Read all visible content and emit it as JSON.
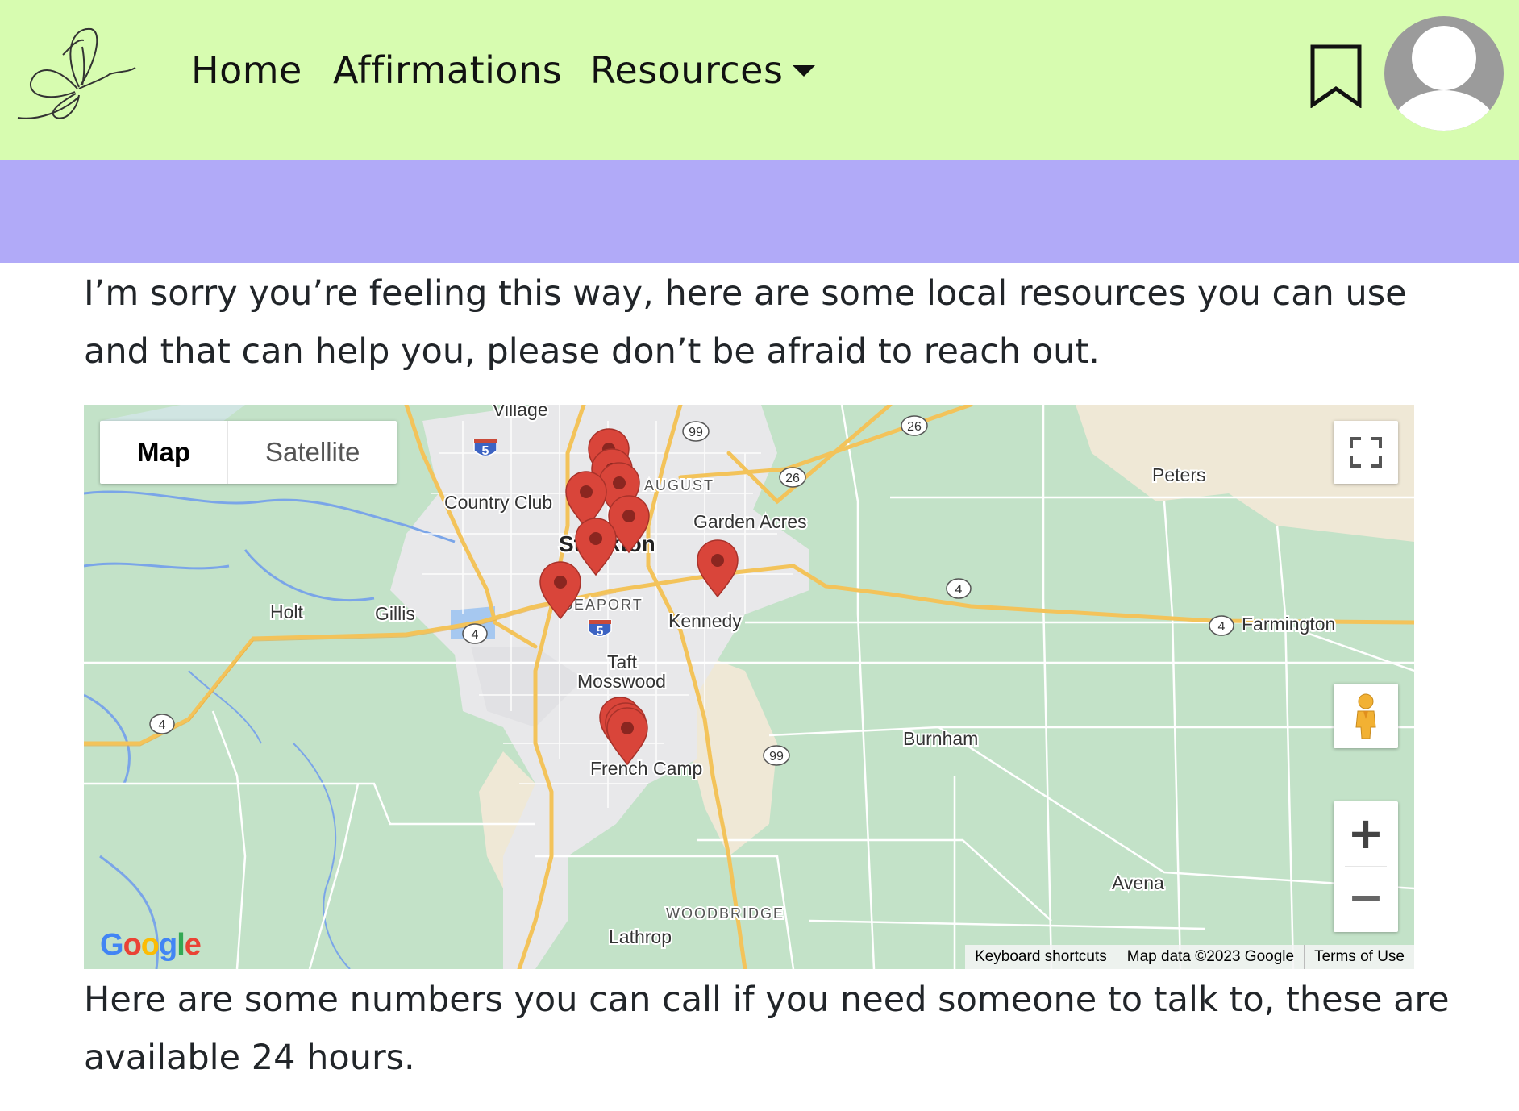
{
  "nav": {
    "links": [
      "Home",
      "Affirmations",
      "Resources"
    ]
  },
  "content": {
    "intro": "I’m sorry you’re feeling this way, here are some local resources you can use and that can help you, please don’t be afraid to reach out.",
    "outro": "Here are some numbers you can call if you need someone to talk to, these are available 24 hours."
  },
  "map": {
    "type_buttons": [
      "Map",
      "Satellite"
    ],
    "labels": {
      "village": "Village",
      "country_club": "Country Club",
      "stockton": "Stockton",
      "august": "AUGUST",
      "garden_acres": "Garden Acres",
      "peters": "Peters",
      "holt": "Holt",
      "gillis": "Gillis",
      "seaport": "SEAPORT",
      "kennedy": "Kennedy",
      "farmington": "Farmington",
      "taft_mosswood_1": "Taft",
      "taft_mosswood_2": "Mosswood",
      "burnham": "Burnham",
      "french_camp": "French Camp",
      "avena": "Avena",
      "woodbridge": "WOODBRIDGE",
      "lathrop": "Lathrop"
    },
    "shields": {
      "r99a": "99",
      "r26a": "26",
      "r26b": "26",
      "i5a": "5",
      "i5b": "5",
      "r4a": "4",
      "r4b": "4",
      "r4c": "4",
      "r4d": "4",
      "r99b": "99"
    },
    "zoom_in": "+",
    "zoom_out": "−",
    "google": "Google",
    "attribution": [
      "Keyboard shortcuts",
      "Map data ©2023 Google",
      "Terms of Use"
    ]
  },
  "colors": {
    "navbar": "#d7fcb0",
    "banner": "#b1aaf8",
    "map_green": "#c3e2c8",
    "marker": "#d9453a"
  }
}
